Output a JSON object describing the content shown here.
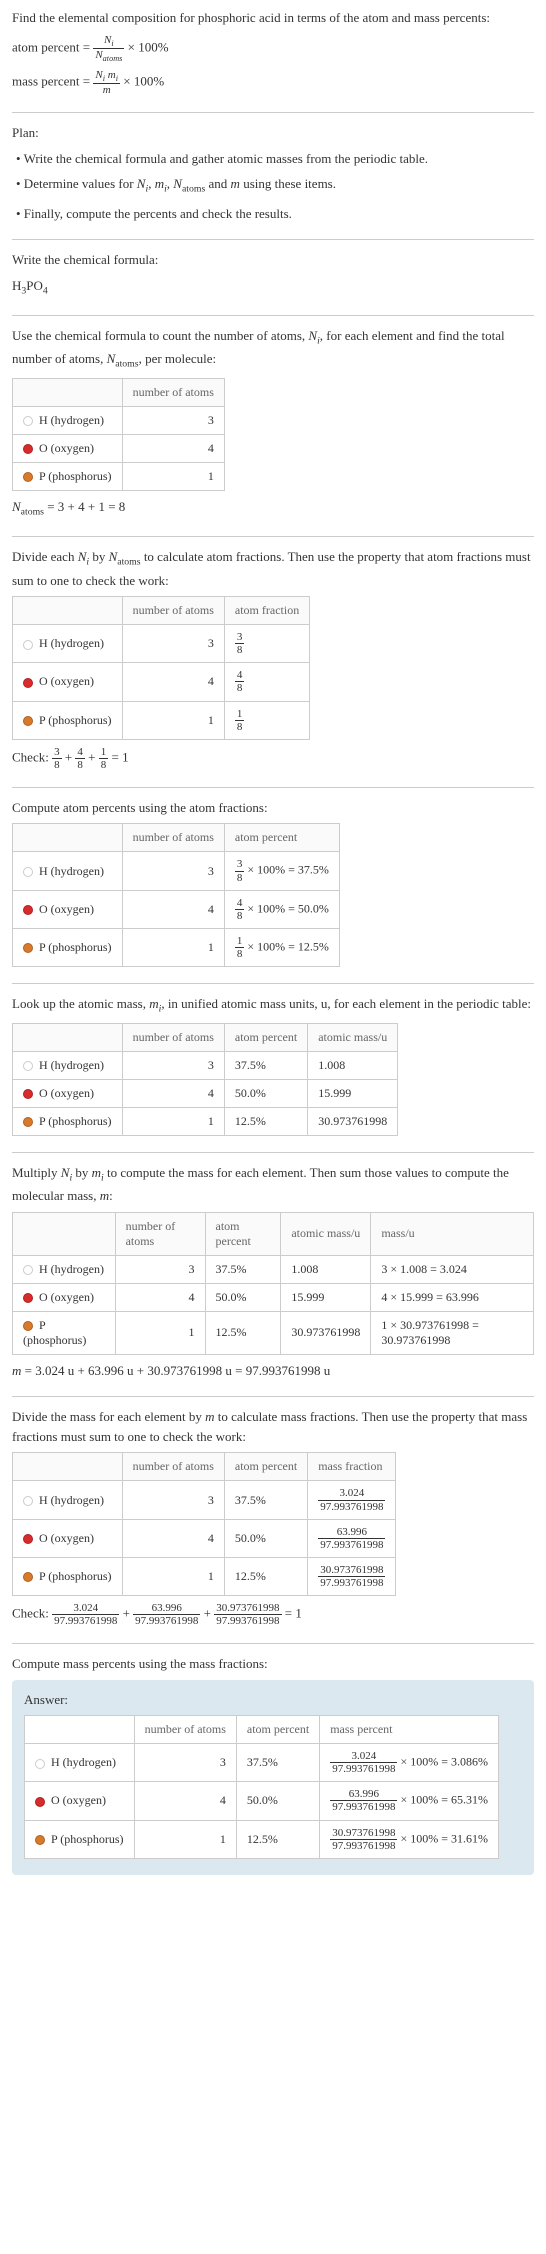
{
  "intro": {
    "line1": "Find the elemental composition for phosphoric acid in terms of the atom and mass percents:",
    "atom_percent_label": "atom percent =",
    "atom_percent_rhs": "× 100%",
    "mass_percent_label": "mass percent =",
    "mass_percent_rhs": "× 100%",
    "frac_atom_num": "N_i",
    "frac_atom_den": "N_atoms",
    "frac_mass_num": "N_i m_i",
    "frac_mass_den": "m"
  },
  "plan": {
    "title": "Plan:",
    "b1": "• Write the chemical formula and gather atomic masses from the periodic table.",
    "b2": "• Determine values for N_i, m_i, N_atoms and m using these items.",
    "b3": "• Finally, compute the percents and check the results."
  },
  "write_formula": {
    "heading": "Write the chemical formula:",
    "formula": "H₃PO₄"
  },
  "count_atoms": {
    "text": "Use the chemical formula to count the number of atoms, N_i, for each element and find the total number of atoms, N_atoms, per molecule:",
    "col1": "number of atoms",
    "h_label": "H (hydrogen)",
    "h_n": "3",
    "o_label": "O (oxygen)",
    "o_n": "4",
    "p_label": "P (phosphorus)",
    "p_n": "1",
    "sum": "N_atoms = 3 + 4 + 1 = 8"
  },
  "atom_fractions": {
    "text": "Divide each N_i by N_atoms to calculate atom fractions. Then use the property that atom fractions must sum to one to check the work:",
    "col1": "number of atoms",
    "col2": "atom fraction",
    "h_frac_num": "3",
    "h_frac_den": "8",
    "o_frac_num": "4",
    "o_frac_den": "8",
    "p_frac_num": "1",
    "p_frac_den": "8",
    "check": "Check: ",
    "check_rhs": " = 1"
  },
  "atom_percents": {
    "text": "Compute atom percents using the atom fractions:",
    "col1": "number of atoms",
    "col2": "atom percent",
    "h_pct": " × 100% = 37.5%",
    "o_pct": " × 100% = 50.0%",
    "p_pct": " × 100% = 12.5%"
  },
  "atomic_mass": {
    "text": "Look up the atomic mass, m_i, in unified atomic mass units, u, for each element in the periodic table:",
    "col1": "number of atoms",
    "col2": "atom percent",
    "col3": "atomic mass/u",
    "h_pct": "37.5%",
    "h_mass": "1.008",
    "o_pct": "50.0%",
    "o_mass": "15.999",
    "p_pct": "12.5%",
    "p_mass": "30.973761998"
  },
  "multiply_mass": {
    "text": "Multiply N_i by m_i to compute the mass for each element. Then sum those values to compute the molecular mass, m:",
    "col1": "number of atoms",
    "col2": "atom percent",
    "col3": "atomic mass/u",
    "col4": "mass/u",
    "h_calc": "3 × 1.008 = 3.024",
    "o_calc": "4 × 15.999 = 63.996",
    "p_calc": "1 × 30.973761998 = 30.973761998",
    "sum": "m = 3.024 u + 63.996 u + 30.973761998 u = 97.993761998 u"
  },
  "mass_fractions": {
    "text": "Divide the mass for each element by m to calculate mass fractions. Then use the property that mass fractions must sum to one to check the work:",
    "col1": "number of atoms",
    "col2": "atom percent",
    "col3": "mass fraction",
    "h_num": "3.024",
    "h_den": "97.993761998",
    "o_num": "63.996",
    "o_den": "97.993761998",
    "p_num": "30.973761998",
    "p_den": "97.993761998",
    "check": "Check: ",
    "check_rhs": " = 1"
  },
  "final": {
    "text": "Compute mass percents using the mass fractions:",
    "answer_label": "Answer:",
    "col1": "number of atoms",
    "col2": "atom percent",
    "col3": "mass percent",
    "h_n": "3",
    "h_pct": "37.5%",
    "h_mass_num": "3.024",
    "h_mass_den": "97.993761998",
    "h_mass_res": "× 100% = 3.086%",
    "o_n": "4",
    "o_pct": "50.0%",
    "o_mass_num": "63.996",
    "o_mass_den": "97.993761998",
    "o_mass_res": "× 100% = 65.31%",
    "p_n": "1",
    "p_pct": "12.5%",
    "p_mass_num": "30.973761998",
    "p_mass_den": "97.993761998",
    "p_mass_res": "× 100% = 31.61%"
  }
}
